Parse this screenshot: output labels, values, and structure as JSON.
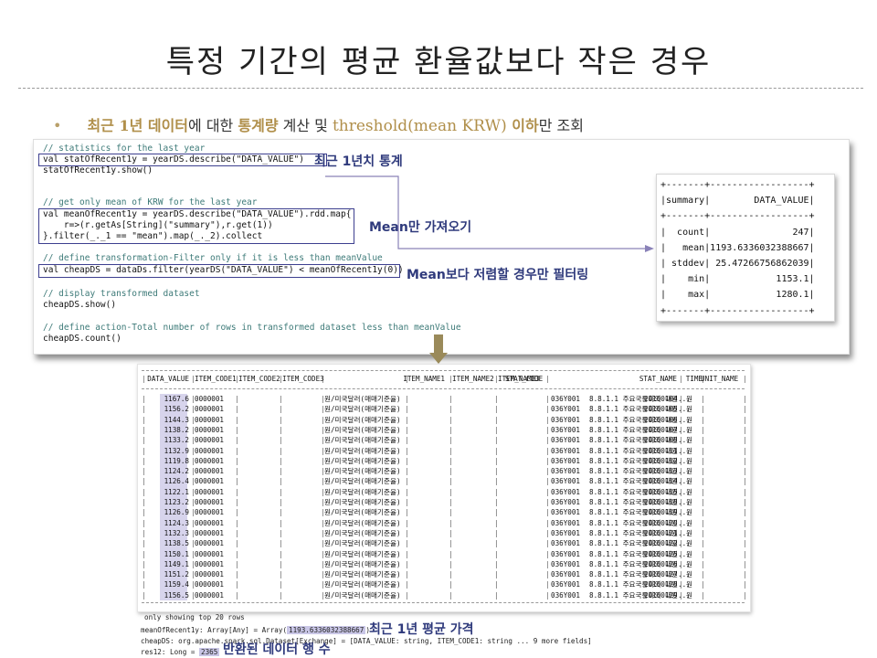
{
  "slide": {
    "title": "특정 기간의 평균 환율값보다 작은 경우",
    "bullet": {
      "part1": "최근 1년 데이터",
      "part2": "에 대한 ",
      "part3": "통계량",
      "part4": " 계산 및 ",
      "part5": "threshold(mean KRW)",
      "part6": " 이하",
      "part7": "만 조회"
    }
  },
  "code": {
    "lines": [
      {
        "text": "// statistics for the last year",
        "kind": "comment"
      },
      {
        "text": "val statOfRecent1y = yearDS.describe(\"DATA_VALUE\")",
        "kind": "code"
      },
      {
        "text": "statOfRecent1y.show()",
        "kind": "code"
      },
      {
        "text": "",
        "kind": "code"
      },
      {
        "text": "// get only mean of KRW for the last year",
        "kind": "comment"
      },
      {
        "text": "val meanOfRecent1y = yearDS.describe(\"DATA_VALUE\").rdd.map{",
        "kind": "code"
      },
      {
        "text": "    r=>(r.getAs[String](\"summary\"),r.get(1))",
        "kind": "code"
      },
      {
        "text": "}.filter(_._1 == \"mean\").map(_._2).collect",
        "kind": "code"
      },
      {
        "text": "// define transformation-Filter only if it is less than meanValue",
        "kind": "comment"
      },
      {
        "text": "val cheapDS = dataDs.filter(yearDS(\"DATA_VALUE\") < meanOfRecent1y(0))",
        "kind": "code"
      },
      {
        "text": "",
        "kind": "code"
      },
      {
        "text": "// display transformed dataset",
        "kind": "comment"
      },
      {
        "text": "cheapDS.show()",
        "kind": "code"
      },
      {
        "text": "",
        "kind": "code"
      },
      {
        "text": "// define action-Total number of rows in transformed dataset less than meanValue",
        "kind": "comment"
      },
      {
        "text": "cheapDS.count()",
        "kind": "code"
      }
    ],
    "callouts": {
      "stats": "최근 1년치 통계",
      "mean": "Mean만 가져오기",
      "filter": "Mean보다 저렴할 경우만 필터링"
    }
  },
  "describe_output": {
    "lines": [
      "+-------+------------------+",
      "|summary|        DATA_VALUE|",
      "+-------+------------------+",
      "|  count|               247|",
      "|   mean|1193.6336032388667|",
      "| stddev| 25.47266756862039|",
      "|    min|            1153.1|",
      "|    max|            1280.1|",
      "+-------+------------------+"
    ]
  },
  "table": {
    "headers": [
      "DATA_VALUE",
      "ITEM_CODE1",
      "ITEM_CODE2",
      "ITEM_CODE3",
      "ITEM_NAME1",
      "ITEM_NAME2",
      "ITEM_NAME3",
      "STAT_CODE",
      "STAT_NAME",
      "TIME",
      "UNIT_NAME"
    ],
    "rows": [
      [
        "1167.6",
        "0000001",
        "",
        "",
        "원/미국달러(매매기준율)",
        "",
        "",
        "036Y001",
        "8.8.1.1 주요국통화의 대원...",
        "20100104",
        "원"
      ],
      [
        "1156.2",
        "0000001",
        "",
        "",
        "원/미국달러(매매기준율)",
        "",
        "",
        "036Y001",
        "8.8.1.1 주요국통화의 대원...",
        "20100105",
        "원"
      ],
      [
        "1144.3",
        "0000001",
        "",
        "",
        "원/미국달러(매매기준율)",
        "",
        "",
        "036Y001",
        "8.8.1.1 주요국통화의 대원...",
        "20100106",
        "원"
      ],
      [
        "1138.2",
        "0000001",
        "",
        "",
        "원/미국달러(매매기준율)",
        "",
        "",
        "036Y001",
        "8.8.1.1 주요국통화의 대원...",
        "20100107",
        "원"
      ],
      [
        "1133.2",
        "0000001",
        "",
        "",
        "원/미국달러(매매기준율)",
        "",
        "",
        "036Y001",
        "8.8.1.1 주요국통화의 대원...",
        "20100108",
        "원"
      ],
      [
        "1132.9",
        "0000001",
        "",
        "",
        "원/미국달러(매매기준율)",
        "",
        "",
        "036Y001",
        "8.8.1.1 주요국통화의 대원...",
        "20100111",
        "원"
      ],
      [
        "1119.8",
        "0000001",
        "",
        "",
        "원/미국달러(매매기준율)",
        "",
        "",
        "036Y001",
        "8.8.1.1 주요국통화의 대원...",
        "20100112",
        "원"
      ],
      [
        "1124.2",
        "0000001",
        "",
        "",
        "원/미국달러(매매기준율)",
        "",
        "",
        "036Y001",
        "8.8.1.1 주요국통화의 대원...",
        "20100113",
        "원"
      ],
      [
        "1126.4",
        "0000001",
        "",
        "",
        "원/미국달러(매매기준율)",
        "",
        "",
        "036Y001",
        "8.8.1.1 주요국통화의 대원...",
        "20100114",
        "원"
      ],
      [
        "1122.1",
        "0000001",
        "",
        "",
        "원/미국달러(매매기준율)",
        "",
        "",
        "036Y001",
        "8.8.1.1 주요국통화의 대원...",
        "20100115",
        "원"
      ],
      [
        "1123.2",
        "0000001",
        "",
        "",
        "원/미국달러(매매기준율)",
        "",
        "",
        "036Y001",
        "8.8.1.1 주요국통화의 대원...",
        "20100118",
        "원"
      ],
      [
        "1126.9",
        "0000001",
        "",
        "",
        "원/미국달러(매매기준율)",
        "",
        "",
        "036Y001",
        "8.8.1.1 주요국통화의 대원...",
        "20100119",
        "원"
      ],
      [
        "1124.3",
        "0000001",
        "",
        "",
        "원/미국달러(매매기준율)",
        "",
        "",
        "036Y001",
        "8.8.1.1 주요국통화의 대원...",
        "20100120",
        "원"
      ],
      [
        "1132.3",
        "0000001",
        "",
        "",
        "원/미국달러(매매기준율)",
        "",
        "",
        "036Y001",
        "8.8.1.1 주요국통화의 대원...",
        "20100121",
        "원"
      ],
      [
        "1138.5",
        "0000001",
        "",
        "",
        "원/미국달러(매매기준율)",
        "",
        "",
        "036Y001",
        "8.8.1.1 주요국통화의 대원...",
        "20100122",
        "원"
      ],
      [
        "1150.1",
        "0000001",
        "",
        "",
        "원/미국달러(매매기준율)",
        "",
        "",
        "036Y001",
        "8.8.1.1 주요국통화의 대원...",
        "20100125",
        "원"
      ],
      [
        "1149.1",
        "0000001",
        "",
        "",
        "원/미국달러(매매기준율)",
        "",
        "",
        "036Y001",
        "8.8.1.1 주요국통화의 대원...",
        "20100126",
        "원"
      ],
      [
        "1151.2",
        "0000001",
        "",
        "",
        "원/미국달러(매매기준율)",
        "",
        "",
        "036Y001",
        "8.8.1.1 주요국통화의 대원...",
        "20100127",
        "원"
      ],
      [
        "1159.4",
        "0000001",
        "",
        "",
        "원/미국달러(매매기준율)",
        "",
        "",
        "036Y001",
        "8.8.1.1 주요국통화의 대원...",
        "20100128",
        "원"
      ],
      [
        "1156.5",
        "0000001",
        "",
        "",
        "원/미국달러(매매기준율)",
        "",
        "",
        "036Y001",
        "8.8.1.1 주요국통화의 대원...",
        "20100129",
        "원"
      ]
    ],
    "footer": "only showing top 20 rows"
  },
  "console": {
    "mean_prefix": "meanOfRecent1y: Array[Any] = Array(",
    "mean_value": "1193.6336032388667",
    "mean_suffix": ")",
    "dataset_line": "cheapDS: org.apache.spark.sql.Dataset[Exchange] = [DATA_VALUE: string, ITEM_CODE1: string ... 9 more fields]",
    "res_prefix": "res12: Long = ",
    "res_value": "2365",
    "callout_mean": "최근 1년 평균 가격",
    "callout_count": "반환된 데이터 행 수"
  },
  "colors": {
    "callout": "#2f3a7c",
    "highlight": "#c9c6e6",
    "gold": "#b08f4a",
    "arrow": "#9a8a5a"
  }
}
